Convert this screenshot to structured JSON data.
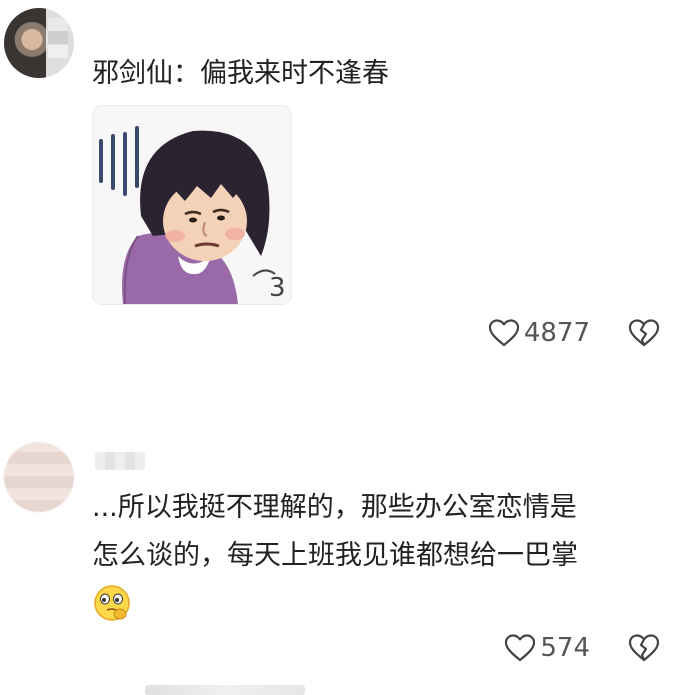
{
  "comments": [
    {
      "text": "邪剑仙：偏我来时不逢春",
      "sticker": "sad-girl-sticker",
      "likes": "4877"
    },
    {
      "text": "...所以我挺不理解的，那些办公室恋情是\n怎么谈的，每天上班我见谁都想给一巴掌",
      "emoji": "pensive-emoji",
      "likes": "574"
    }
  ],
  "icons": {
    "like": "heart-outline-icon",
    "dislike": "broken-heart-icon"
  },
  "colors": {
    "text": "#222222",
    "count": "#555555",
    "icon": "#444444",
    "sticker_hair": "#2b2430",
    "sticker_shirt": "#9a6aa8"
  }
}
